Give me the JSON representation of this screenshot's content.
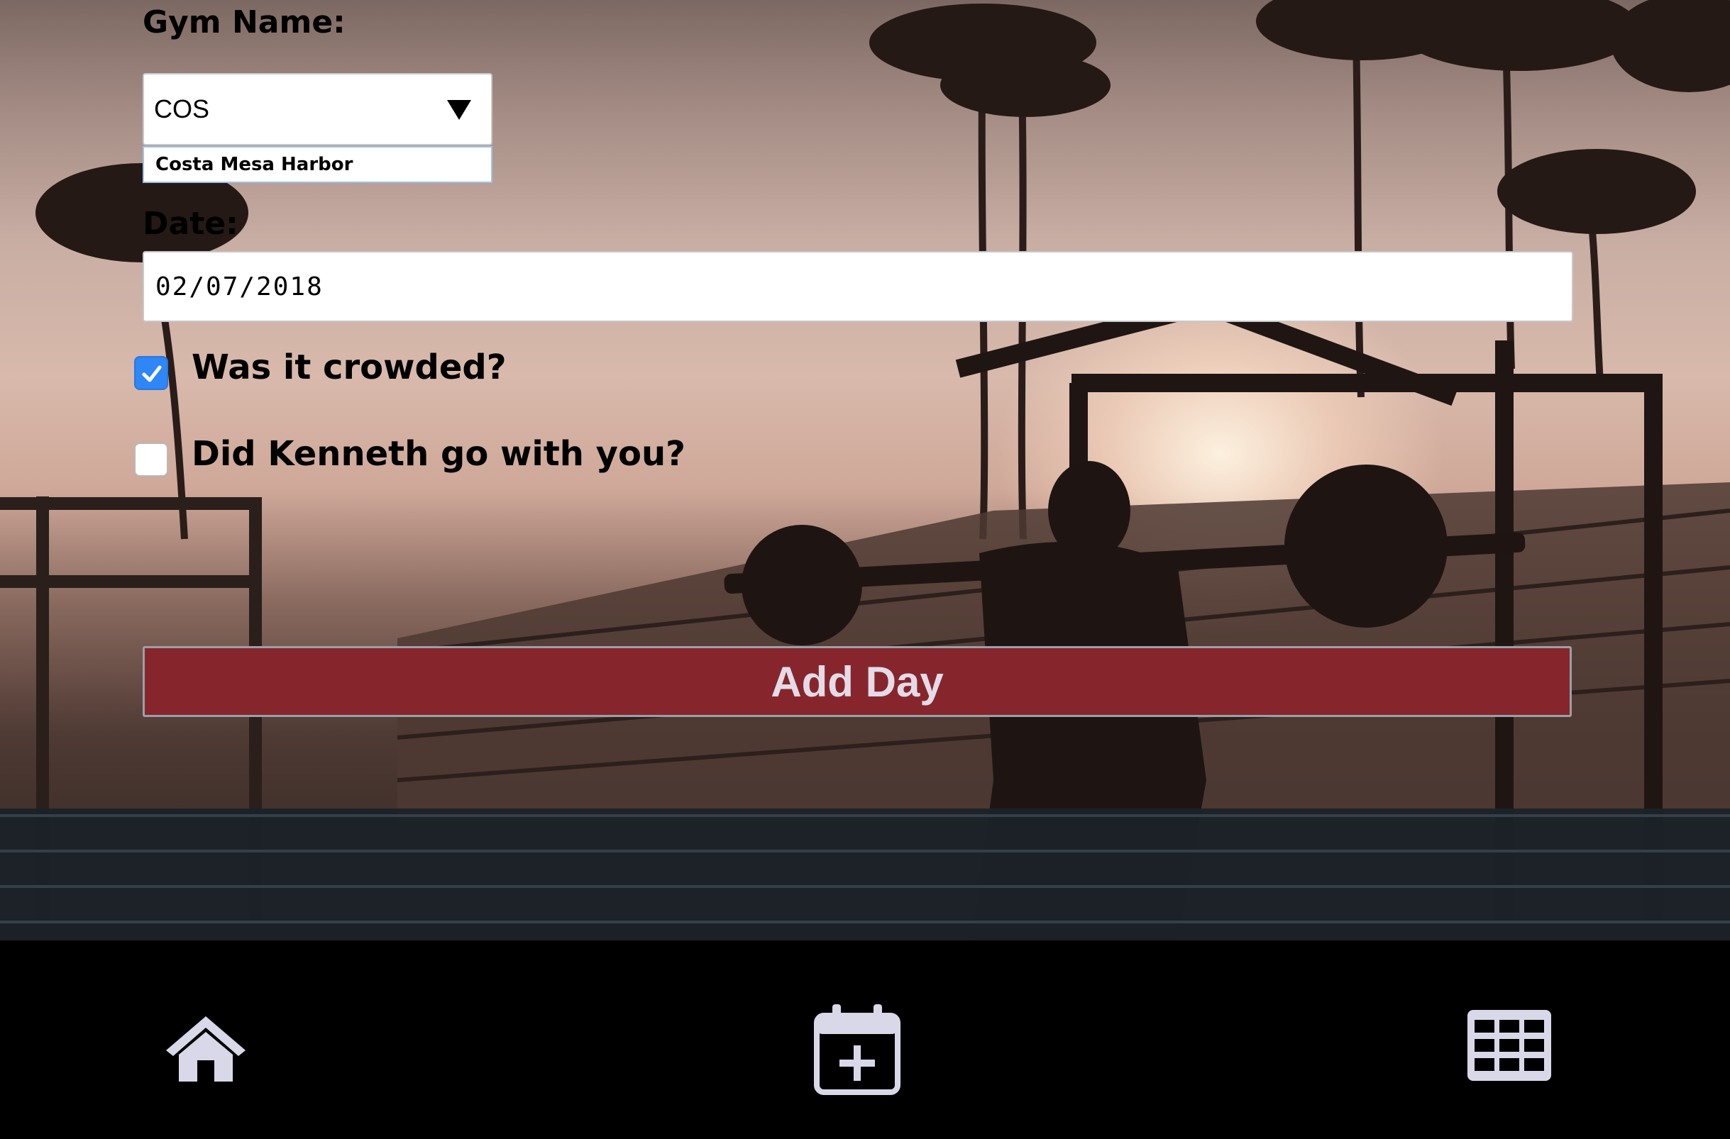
{
  "form": {
    "gym_label": "Gym Name:",
    "gym_select_value": "COS",
    "gym_dropdown_option": "Costa Mesa Harbor",
    "date_label": "Date:",
    "date_value": "02/07/2018",
    "crowded_label": "Was it crowded?",
    "crowded_checked": true,
    "kenneth_label": "Did Kenneth go with you?",
    "kenneth_checked": false,
    "submit_label": "Add Day"
  },
  "nav": {
    "items": [
      {
        "icon": "home-icon"
      },
      {
        "icon": "calendar-plus-icon"
      },
      {
        "icon": "grid-table-icon"
      }
    ]
  },
  "colors": {
    "button_bg": "#86262c",
    "button_text": "#e3dbe7",
    "checkbox_checked": "#2f86f6",
    "nav_bg": "#000000",
    "nav_icon": "#d8d8e8"
  }
}
